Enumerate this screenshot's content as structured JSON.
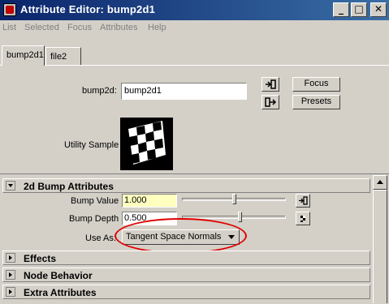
{
  "window": {
    "title": "Attribute Editor: bump2d1",
    "minimize_label": "_",
    "maximize_label": "□",
    "close_label": "✕"
  },
  "menu": {
    "items": [
      "List",
      "Selected",
      "Focus",
      "Attributes",
      "Help"
    ]
  },
  "tabs": [
    {
      "label": "bump2d1",
      "active": true
    },
    {
      "label": "file2",
      "active": false
    }
  ],
  "header": {
    "node_label": "bump2d:",
    "node_value": "bump2d1",
    "focus_button": "Focus",
    "presets_button": "Presets",
    "swatch_label": "Utility Sample"
  },
  "sections": {
    "bump_2d": {
      "title": "2d Bump Attributes",
      "expanded": true,
      "bump_value": {
        "label": "Bump Value",
        "value": "1.000",
        "slider_fraction": 0.65
      },
      "bump_depth": {
        "label": "Bump Depth",
        "value": "0.500",
        "slider_fraction": 0.7
      },
      "use_as": {
        "label": "Use As:",
        "value": "Tangent Space Normals"
      }
    },
    "effects": {
      "title": "Effects",
      "expanded": false
    },
    "node_behavior": {
      "title": "Node Behavior",
      "expanded": false
    },
    "extra_attributes": {
      "title": "Extra Attributes",
      "expanded": false
    }
  },
  "colors": {
    "highlight_field": "#ffffc0",
    "annotation_ellipse": "#e00000",
    "title_bar": "#0a246a"
  }
}
